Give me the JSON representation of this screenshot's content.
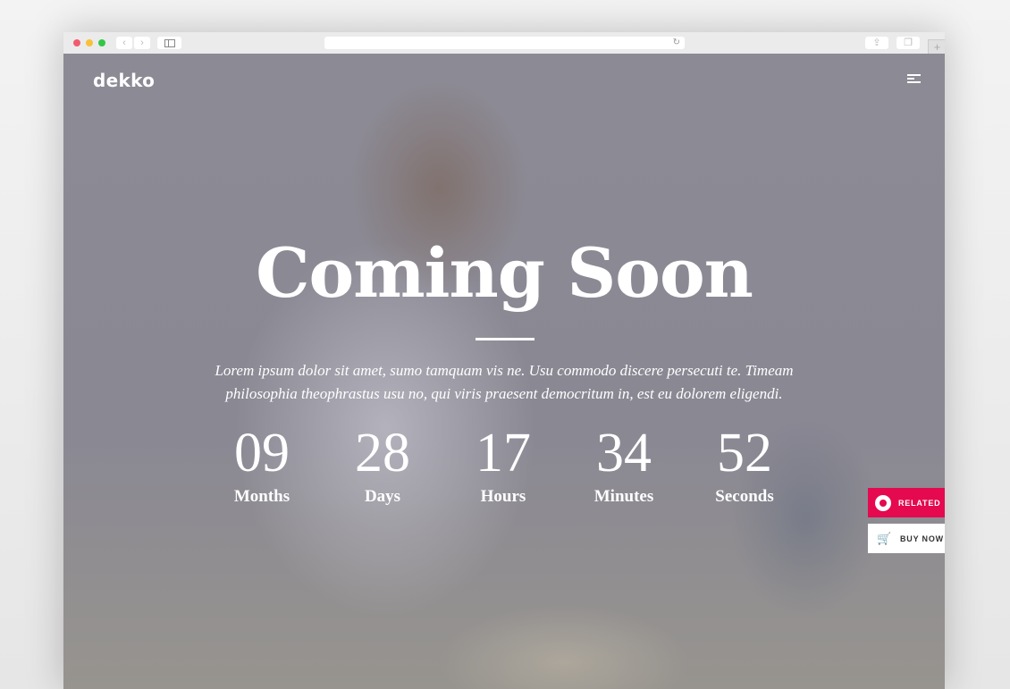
{
  "browser": {
    "back_icon": "‹",
    "forward_icon": "›",
    "reload_icon": "↻",
    "share_icon": "⇪",
    "tabs_icon": "❐",
    "new_tab_icon": "+"
  },
  "header": {
    "logo": "dekko",
    "menu_icon": "hamburger-menu"
  },
  "hero": {
    "title": "Coming Soon",
    "description": "Lorem ipsum dolor sit amet, sumo tamquam vis ne. Usu commodo discere persecuti te. Timeam philosophia theophrastus usu no, qui viris praesent democritum in, est eu dolorem eligendi."
  },
  "countdown": [
    {
      "value": "09",
      "label": "Months"
    },
    {
      "value": "28",
      "label": "Days"
    },
    {
      "value": "17",
      "label": "Hours"
    },
    {
      "value": "34",
      "label": "Minutes"
    },
    {
      "value": "52",
      "label": "Seconds"
    }
  ],
  "side_buttons": {
    "related": "RELATED",
    "buy_now": "BUY NOW",
    "cart_icon": "🛒"
  },
  "colors": {
    "accent": "#e5094f",
    "overlay": "#8a8893"
  }
}
